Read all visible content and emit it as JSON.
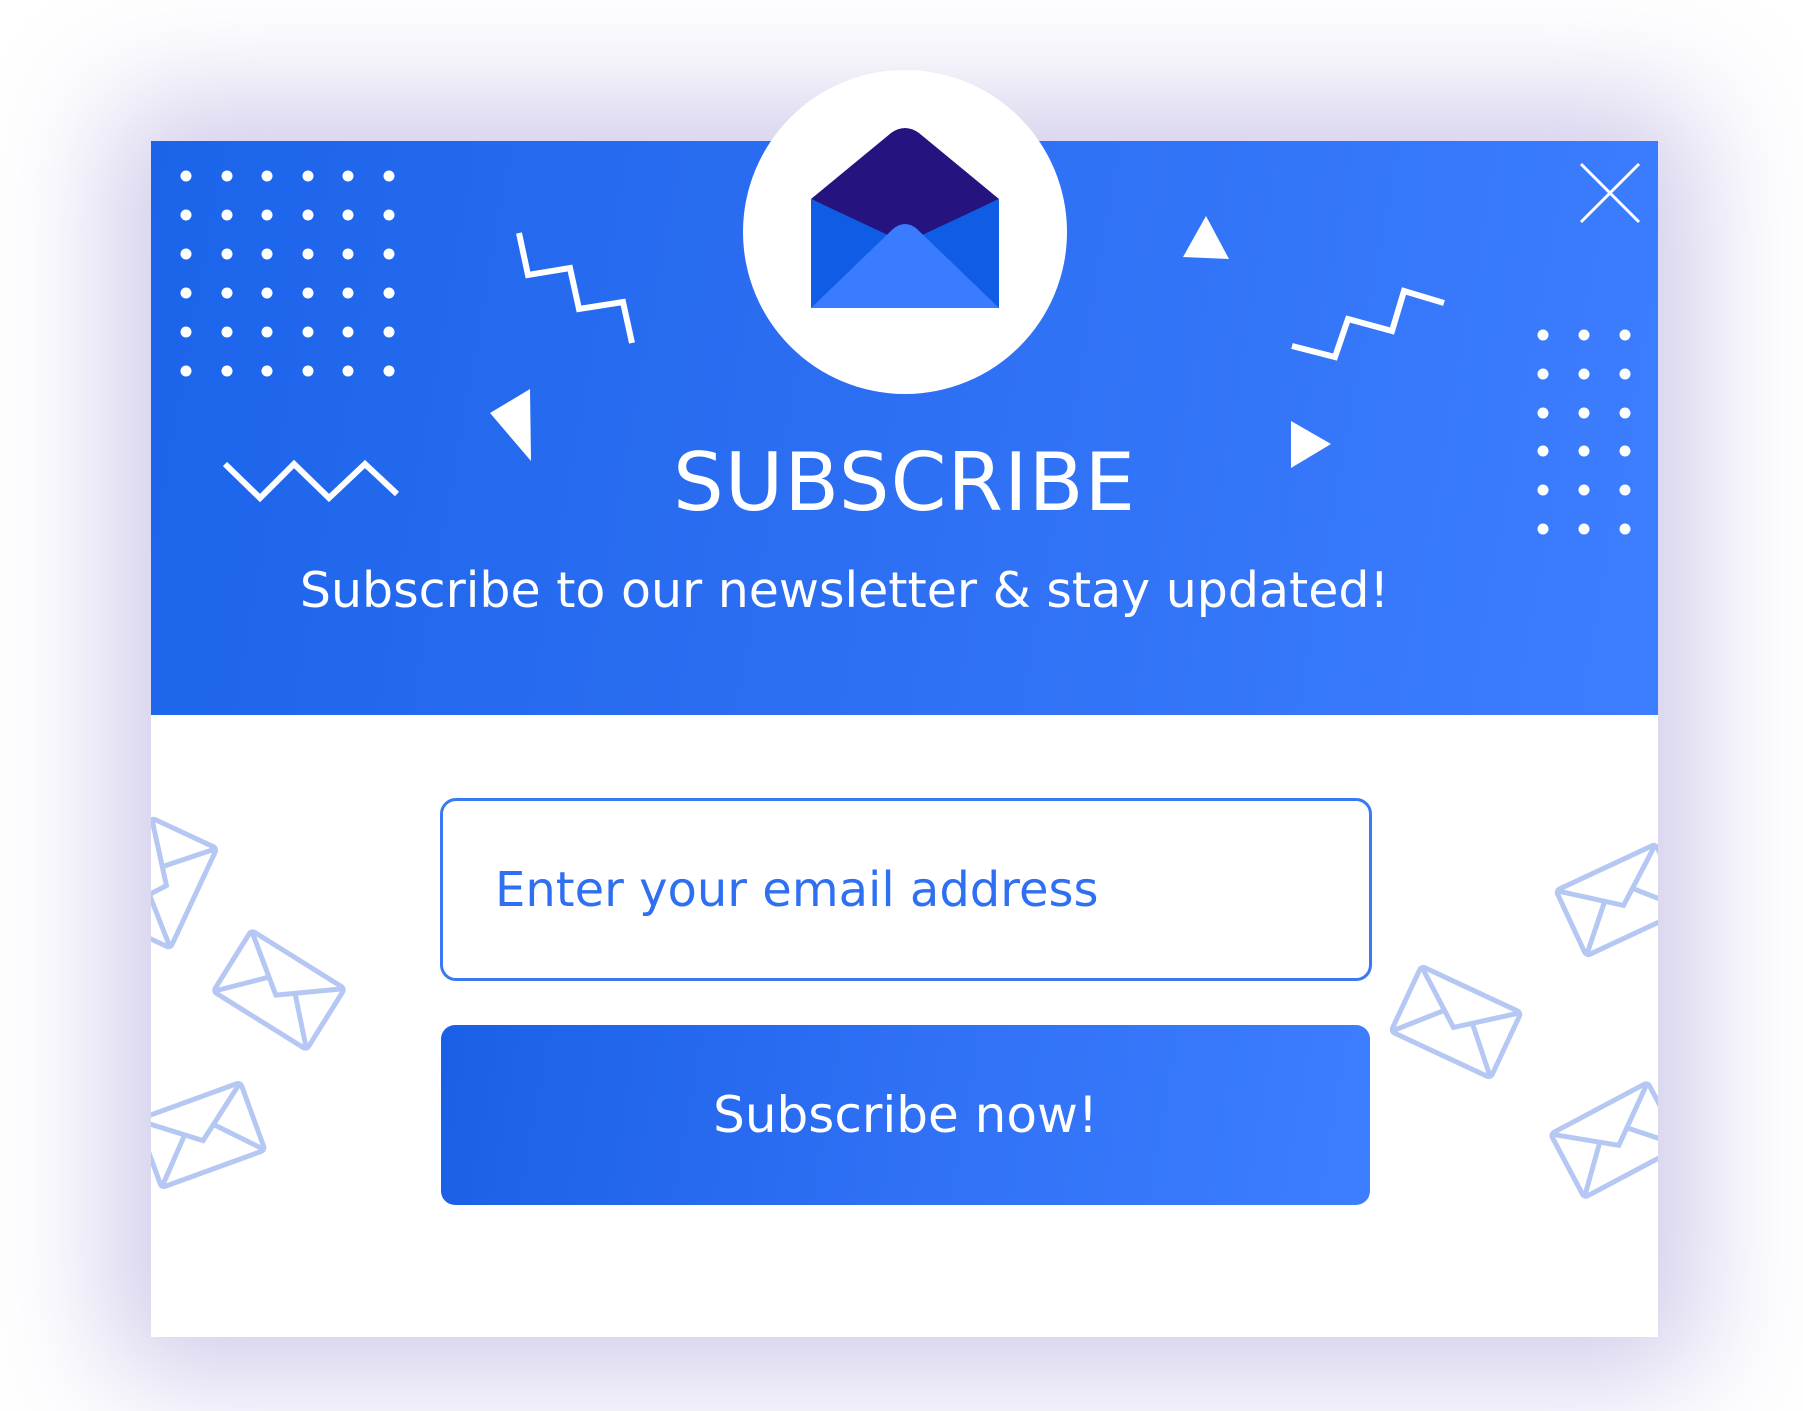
{
  "popup": {
    "title": "SUBSCRIBE",
    "subtitle": "Subscribe to our newsletter & stay updated!",
    "email_placeholder": "Enter your email address",
    "button_label": "Subscribe now!",
    "icons": {
      "close": "close-icon",
      "logo": "envelope-open-icon",
      "pattern": "envelope-outline-icon"
    }
  },
  "colors": {
    "header_start": "#1b64ea",
    "header_end": "#3d7eff",
    "button": "#2c6ef2",
    "input_border": "#3b79f2",
    "placeholder_text": "#2f6ff1",
    "envelope_flap": "#25137f",
    "envelope_body": "#0f5de4",
    "envelope_inner": "#3b7bff",
    "pattern_envelope": "#b5c8f4"
  }
}
